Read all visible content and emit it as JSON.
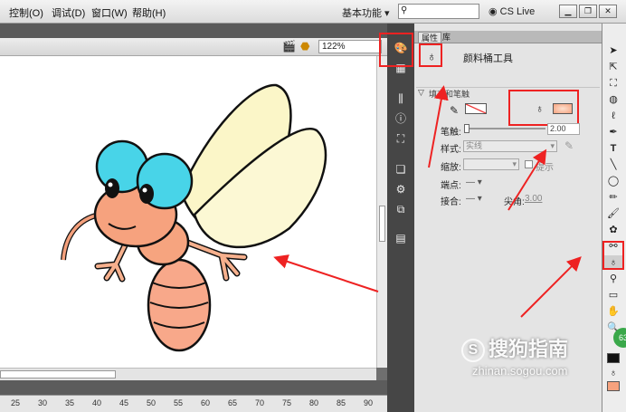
{
  "menu": [
    "控制(O)",
    "调试(D)",
    "窗口(W)",
    "帮助(H)"
  ],
  "workspace_label": "基本功能",
  "search": {
    "placeholder": ""
  },
  "cs_live": "CS Live",
  "zoom": "122%",
  "ruler_ticks": [
    "25",
    "30",
    "35",
    "40",
    "45",
    "50",
    "55",
    "60",
    "65",
    "70",
    "75",
    "80",
    "85",
    "90"
  ],
  "panel": {
    "tabs": [
      "属性",
      "库"
    ],
    "tool_name": "颜料桶工具",
    "section": "填充和笔触",
    "stroke_label": "笔触:",
    "stroke_value": "2.00",
    "style_label": "样式:",
    "style_value": "实线",
    "scale_label": "缩放:",
    "hint_label": "提示",
    "cap_label": "端点:",
    "join_label": "接合:",
    "miter_label": "尖角:",
    "miter_value": "3.00"
  },
  "watermark": {
    "text": "搜狗指南",
    "url": "zhinan.sogou.com"
  },
  "badge": "63",
  "colors": {
    "highlight": "#e22222",
    "fill_swatch": "#f6a27e"
  }
}
